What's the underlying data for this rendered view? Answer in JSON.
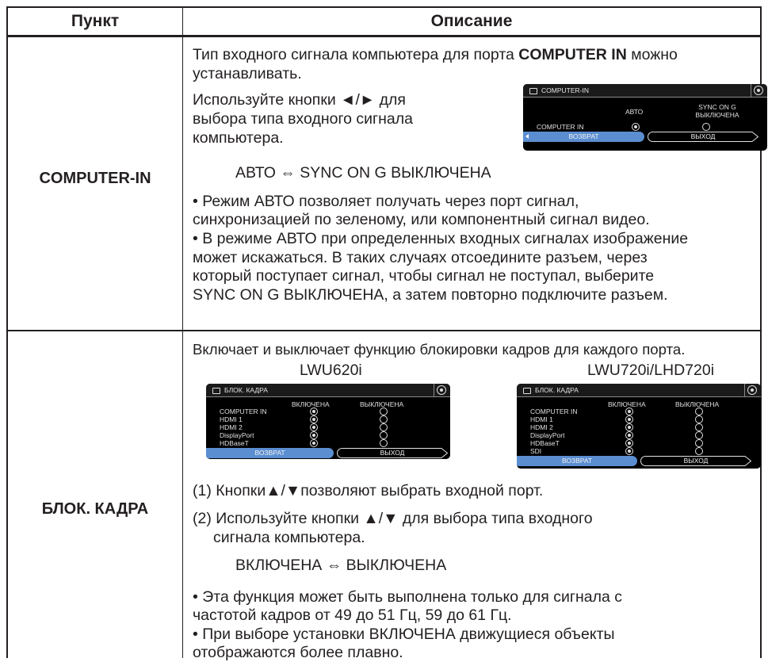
{
  "header": {
    "col1": "Пункт",
    "col2": "Описание"
  },
  "row1": {
    "item": "COMPUTER-IN",
    "intro1": "Тип входного сигнала компьютера для порта ",
    "intro_bold": "COMPUTER IN",
    "intro2": " можно",
    "intro3": "устанавливать.",
    "use1": "Используйте кнопки ◄/► для",
    "use2": "выбора типа входного сигнала",
    "use3": "компьютера.",
    "cycle": "АВТО ⇔ SYNC ON G ВЫКЛЮЧЕНА",
    "notes": [
      "• Режим АВТО позволяет получать через порт сигнал,",
      "синхронизацией по зеленому, или компонентный сигнал видео.",
      "• В режиме АВТО при определенных входных сигналах изображение",
      "может искажаться. В таких случаях отсоедините разъем, через",
      "который поступает сигнал, чтобы сигнал не поступал, выберите",
      "SYNC ON G ВЫКЛЮЧЕНА, а затем повторно подключите разъем."
    ],
    "osd": {
      "title": "COMPUTER-IN",
      "col_auto": "АВТО",
      "col_sync1": "SYNC ON G",
      "col_sync2": "ВЫКЛЮЧЕНА",
      "row_label": "COMPUTER IN",
      "back": "ВОЗВРАТ",
      "exit": "ВЫХОД"
    }
  },
  "row2": {
    "item": "БЛОК. КАДРА",
    "intro": "Включает и выключает функцию блокировки кадров для каждого порта.",
    "model1": "LWU620i",
    "model2": "LWU720i/LHD720i",
    "step1": "(1) Кнопки▲/▼позволяют выбрать входной порт.",
    "step2a": "(2) Используйте кнопки ▲/▼ для выбора типа входного",
    "step2b": "сигнала компьютера.",
    "cycle": "ВКЛЮЧЕНА ⇔ ВЫКЛЮЧЕНА",
    "notes": [
      "• Эта функция может быть выполнена только для сигнала с",
      "частотой кадров от 49 до 51 Гц,  59 до 61 Гц.",
      "• При выборе установки ВКЛЮЧЕНА движущиеся объекты",
      "отображаются более плавно."
    ],
    "osd": {
      "title": "БЛОК. КАДРА",
      "col_on": "ВКЛЮЧЕНА",
      "col_off": "ВЫКЛЮЧЕНА",
      "ports1": [
        "COMPUTER IN",
        "HDMI 1",
        "HDMI 2",
        "DisplayPort",
        "HDBaseT"
      ],
      "ports2": [
        "COMPUTER IN",
        "HDMI 1",
        "HDMI 2",
        "DisplayPort",
        "HDBaseT",
        "SDI"
      ],
      "back": "ВОЗВРАТ",
      "exit": "ВЫХОД"
    }
  }
}
